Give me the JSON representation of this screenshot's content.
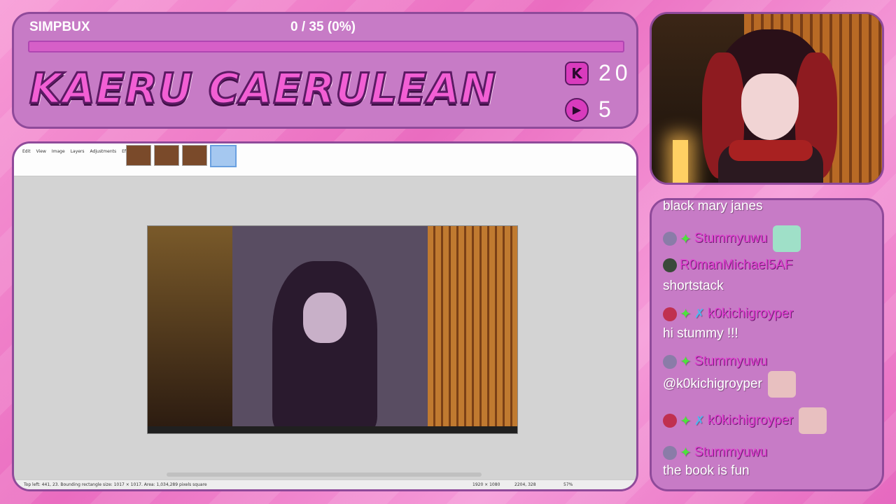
{
  "header": {
    "simpbux_label": "SIMPBUX",
    "progress_text": "0 / 35 (0%)",
    "progress_fraction": 0,
    "streamer_name": "KAERU CAERULEAN",
    "stats": [
      {
        "icon": "kick-icon",
        "glyph": "K",
        "value": "20"
      },
      {
        "icon": "play-icon",
        "glyph": "▶",
        "value": "5"
      }
    ]
  },
  "screen": {
    "menu": [
      "Edit",
      "View",
      "Image",
      "Layers",
      "Adjustments",
      "Effects"
    ],
    "status_text": "Top left: 441, 23. Bounding rectangle size: 1017 × 1017. Area: 1,034,289 pixels square",
    "image_size": "1920 × 1080",
    "cursor_pos": "2204, 328",
    "zoom": "57%"
  },
  "chat": {
    "messages": [
      {
        "type": "text",
        "text": "black mary janes"
      },
      {
        "type": "user",
        "user": "Stummyuwu",
        "badges": [
          "avatar",
          "sparkle"
        ],
        "emote": "frog-emote"
      },
      {
        "type": "user",
        "user": "R0manMichael5AF",
        "badges": [
          "avatar"
        ]
      },
      {
        "type": "text",
        "text": "shortstack"
      },
      {
        "type": "user",
        "user": "k0kichigroyper",
        "badges": [
          "avatar",
          "sparkle",
          "sword"
        ]
      },
      {
        "type": "text",
        "text": "hi stummy !!!"
      },
      {
        "type": "user",
        "user": "Stummyuwu",
        "badges": [
          "avatar",
          "sparkle"
        ]
      },
      {
        "type": "text",
        "text": "@k0kichigroyper",
        "emote": "kiss-emote"
      },
      {
        "type": "user",
        "user": "k0kichigroyper",
        "badges": [
          "avatar",
          "sparkle",
          "sword"
        ],
        "emote": "kiss-emote"
      },
      {
        "type": "user",
        "user": "Stummyuwu",
        "badges": [
          "avatar",
          "sparkle"
        ]
      },
      {
        "type": "text",
        "text": "the book is fun"
      }
    ]
  },
  "colors": {
    "panel": "#c77bc6",
    "panel_border": "#8f4a9a",
    "username": "#e03ed0",
    "sparkle_badge": "#4ee23d",
    "sword_badge": "#4db7f0"
  }
}
